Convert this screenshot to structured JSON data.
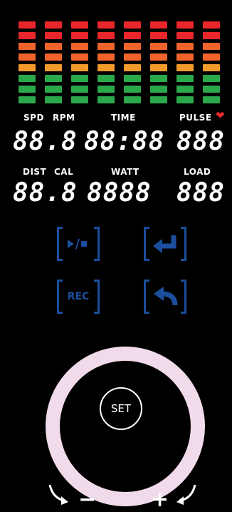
{
  "meter": {
    "columns": 8,
    "segment_colors": [
      "#e8262b",
      "#e8262b",
      "#f0632a",
      "#f0632a",
      "#f39a2d",
      "#2aa84a",
      "#2aa84a",
      "#2aa84a"
    ]
  },
  "labels": {
    "spd": "SPD",
    "rpm": "RPM",
    "time": "TIME",
    "pulse": "PULSE",
    "dist": "DIST",
    "cal": "CAL",
    "watt": "WATT",
    "load": "LOAD"
  },
  "displays": {
    "spd_rpm": "88.8",
    "time": "88:88",
    "pulse": "888",
    "dist_cal": "88.8",
    "watt": "8888",
    "load": "888"
  },
  "buttons": {
    "rec": "REC",
    "set": "SET",
    "minus": "−",
    "plus": "+"
  },
  "icons": {
    "heart": "heart-icon",
    "play_stop": "play-stop-icon",
    "enter": "enter-icon",
    "back": "back-icon",
    "rotate_ccw": "rotate-ccw-icon",
    "rotate_cw": "rotate-cw-icon"
  },
  "colors": {
    "accent_blue": "#1b4e9c",
    "ring": "#f1dbea",
    "heart": "#e32b2b"
  }
}
